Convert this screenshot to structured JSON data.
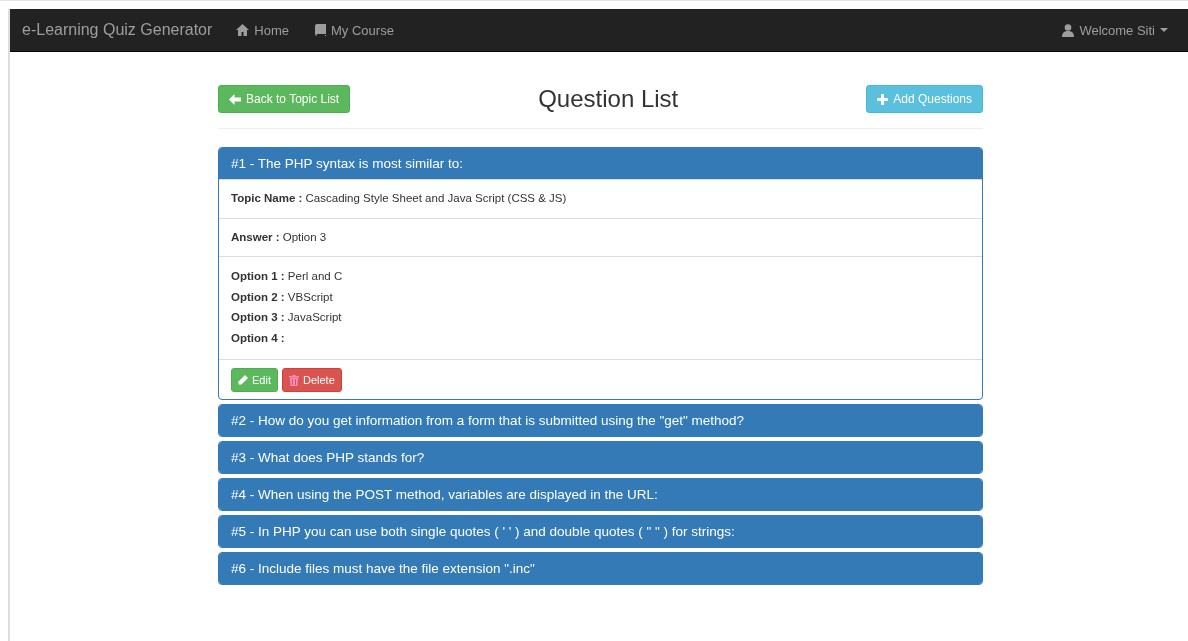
{
  "navbar": {
    "brand": "e-Learning Quiz Generator",
    "links": [
      {
        "label": "Home"
      },
      {
        "label": "My Course"
      }
    ],
    "user": "Welcome Siti"
  },
  "header": {
    "back_button": "Back to Topic List",
    "title": "Question List",
    "add_button": "Add Questions"
  },
  "questions": [
    {
      "title": "#1 - The PHP syntax is most similar to:",
      "expanded": true,
      "topic": {
        "label": "Topic Name :",
        "value": "Cascading Style Sheet and Java Script (CSS & JS)"
      },
      "answer": {
        "label": "Answer :",
        "value": "Option 3"
      },
      "options": [
        {
          "label": "Option 1 :",
          "value": "Perl and C"
        },
        {
          "label": "Option 2 :",
          "value": "VBScript"
        },
        {
          "label": "Option 3 :",
          "value": "JavaScript"
        },
        {
          "label": "Option 4 :"
        }
      ],
      "edit_button": "Edit",
      "delete_button": "Delete"
    },
    {
      "title": "#2 - How do you get information from a form that is submitted using the \"get\" method?",
      "expanded": false
    },
    {
      "title": "#3 - What does PHP stands for?",
      "expanded": false
    },
    {
      "title": "#4 - When using the POST method, variables are displayed in the URL:",
      "expanded": false
    },
    {
      "title": "#5 - In PHP you can use both single quotes ( ' ' ) and double quotes ( \" \" ) for strings:",
      "expanded": false
    },
    {
      "title": "#6 - Include files must have the file extension \".inc\"",
      "expanded": false
    }
  ]
}
